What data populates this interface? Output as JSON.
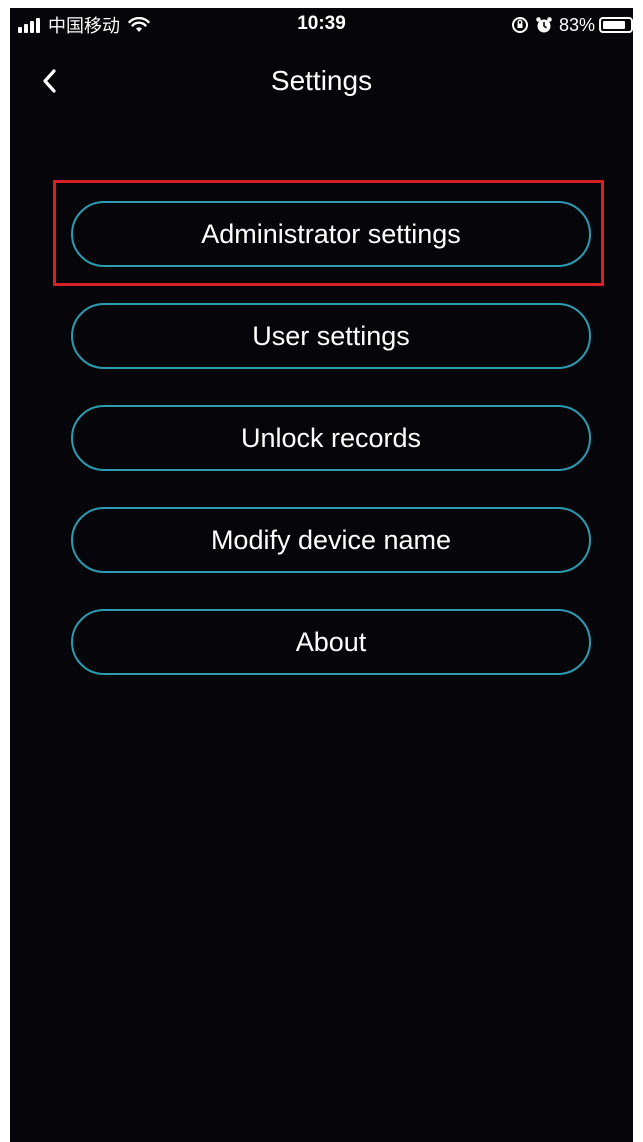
{
  "status_bar": {
    "carrier": "中国移动",
    "time": "10:39",
    "battery_percent": "83%",
    "battery_level": 0.83,
    "icons": [
      "signal-icon",
      "wifi-icon",
      "orientation-lock-icon",
      "alarm-icon",
      "battery-icon"
    ]
  },
  "nav": {
    "back_icon": "chevron-left-icon",
    "title": "Settings"
  },
  "menu": {
    "items": [
      {
        "label": "Administrator settings",
        "highlighted": true
      },
      {
        "label": "User settings"
      },
      {
        "label": "Unlock records"
      },
      {
        "label": "Modify device name"
      },
      {
        "label": "About"
      }
    ]
  },
  "colors": {
    "background": "#06060a",
    "button_border": "#2a9bb0",
    "highlight": "#d61f26",
    "text": "#ffffff"
  }
}
